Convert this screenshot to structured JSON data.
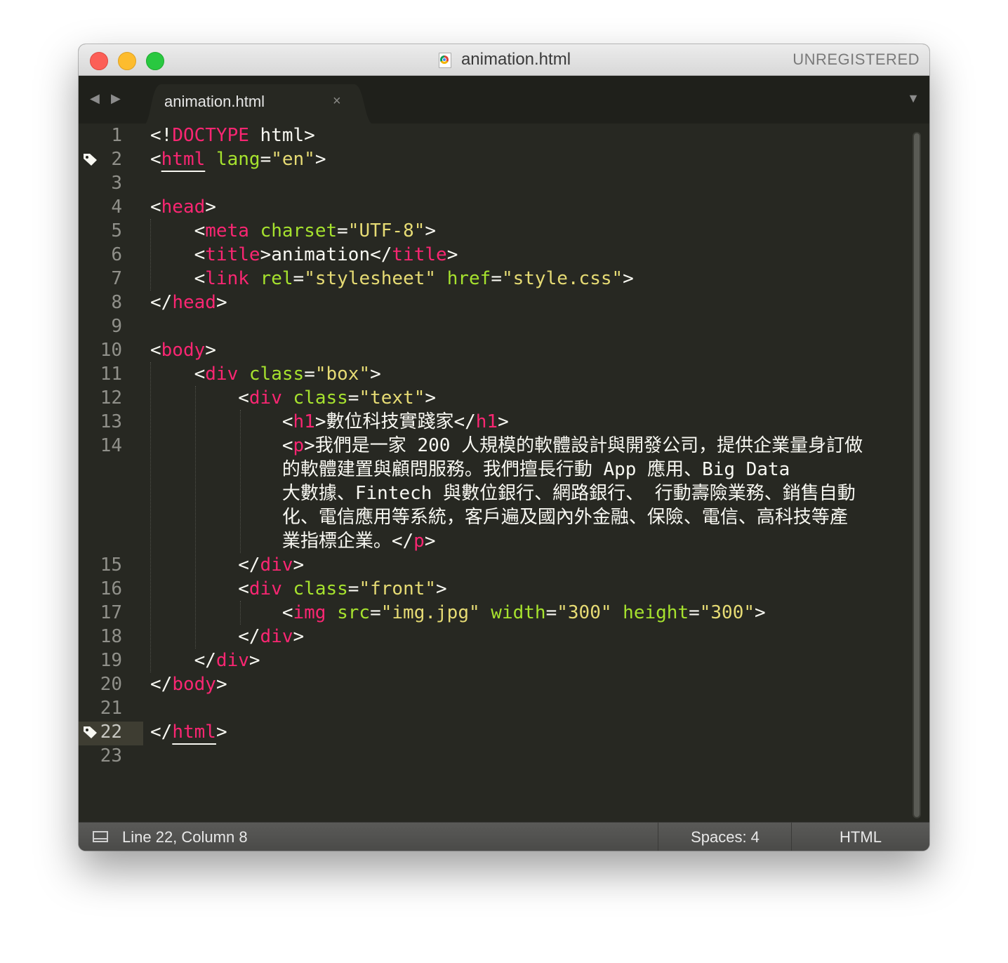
{
  "window": {
    "title": "animation.html",
    "license": "UNREGISTERED"
  },
  "tabs": {
    "back_icon": "◀",
    "forward_icon": "▶",
    "active": {
      "label": "animation.html",
      "close_icon": "×"
    },
    "menu_icon": "▼"
  },
  "editor": {
    "current_line": 22,
    "bookmarked_lines": [
      2,
      22
    ],
    "line_numbers": [
      "1",
      "2",
      "3",
      "4",
      "5",
      "6",
      "7",
      "8",
      "9",
      "10",
      "11",
      "12",
      "13",
      "14",
      "15",
      "16",
      "17",
      "18",
      "19",
      "20",
      "21",
      "22",
      "23"
    ],
    "lines": [
      [
        [
          "t",
          "<!"
        ],
        [
          "k",
          "DOCTYPE"
        ],
        [
          "t",
          " html>"
        ]
      ],
      [
        [
          "t",
          "<"
        ],
        [
          "ku",
          "html"
        ],
        [
          "t",
          " "
        ],
        [
          "a",
          "lang"
        ],
        [
          "t",
          "="
        ],
        [
          "s",
          "\"en\""
        ],
        [
          "t",
          ">"
        ]
      ],
      [],
      [
        [
          "t",
          "<"
        ],
        [
          "k",
          "head"
        ],
        [
          "t",
          ">"
        ]
      ],
      [
        [
          "t",
          "    <"
        ],
        [
          "k",
          "meta"
        ],
        [
          "t",
          " "
        ],
        [
          "a",
          "charset"
        ],
        [
          "t",
          "="
        ],
        [
          "s",
          "\"UTF-8\""
        ],
        [
          "t",
          ">"
        ]
      ],
      [
        [
          "t",
          "    <"
        ],
        [
          "k",
          "title"
        ],
        [
          "t",
          ">animation</"
        ],
        [
          "k",
          "title"
        ],
        [
          "t",
          ">"
        ]
      ],
      [
        [
          "t",
          "    <"
        ],
        [
          "k",
          "link"
        ],
        [
          "t",
          " "
        ],
        [
          "a",
          "rel"
        ],
        [
          "t",
          "="
        ],
        [
          "s",
          "\"stylesheet\""
        ],
        [
          "t",
          " "
        ],
        [
          "a",
          "href"
        ],
        [
          "t",
          "="
        ],
        [
          "s",
          "\"style.css\""
        ],
        [
          "t",
          ">"
        ]
      ],
      [
        [
          "t",
          "</"
        ],
        [
          "k",
          "head"
        ],
        [
          "t",
          ">"
        ]
      ],
      [],
      [
        [
          "t",
          "<"
        ],
        [
          "k",
          "body"
        ],
        [
          "t",
          ">"
        ]
      ],
      [
        [
          "t",
          "    <"
        ],
        [
          "k",
          "div"
        ],
        [
          "t",
          " "
        ],
        [
          "a",
          "class"
        ],
        [
          "t",
          "="
        ],
        [
          "s",
          "\"box\""
        ],
        [
          "t",
          ">"
        ]
      ],
      [
        [
          "t",
          "        <"
        ],
        [
          "k",
          "div"
        ],
        [
          "t",
          " "
        ],
        [
          "a",
          "class"
        ],
        [
          "t",
          "="
        ],
        [
          "s",
          "\"text\""
        ],
        [
          "t",
          ">"
        ]
      ],
      [
        [
          "t",
          "            <"
        ],
        [
          "k",
          "h1"
        ],
        [
          "t",
          ">數位科技實踐家</"
        ],
        [
          "k",
          "h1"
        ],
        [
          "t",
          ">"
        ]
      ],
      [
        [
          "t",
          "            <"
        ],
        [
          "k",
          "p"
        ],
        [
          "t",
          ">我們是一家 200 人規模的軟體設計與開發公司，提供企業量身訂做"
        ]
      ],
      [
        [
          "t",
          "            的軟體建置與顧問服務。我們擅長行動 App 應用、Big Data"
        ]
      ],
      [
        [
          "t",
          "            大數據、Fintech 與數位銀行、網路銀行、 行動壽險業務、銷售自動"
        ]
      ],
      [
        [
          "t",
          "            化、電信應用等系統，客戶遍及國內外金融、保險、電信、高科技等產"
        ]
      ],
      [
        [
          "t",
          "            業指標企業。</"
        ],
        [
          "k",
          "p"
        ],
        [
          "t",
          ">"
        ]
      ],
      [
        [
          "t",
          "        </"
        ],
        [
          "k",
          "div"
        ],
        [
          "t",
          ">"
        ]
      ],
      [
        [
          "t",
          "        <"
        ],
        [
          "k",
          "div"
        ],
        [
          "t",
          " "
        ],
        [
          "a",
          "class"
        ],
        [
          "t",
          "="
        ],
        [
          "s",
          "\"front\""
        ],
        [
          "t",
          ">"
        ]
      ],
      [
        [
          "t",
          "            <"
        ],
        [
          "k",
          "img"
        ],
        [
          "t",
          " "
        ],
        [
          "a",
          "src"
        ],
        [
          "t",
          "="
        ],
        [
          "s",
          "\"img.jpg\""
        ],
        [
          "t",
          " "
        ],
        [
          "a",
          "width"
        ],
        [
          "t",
          "="
        ],
        [
          "s",
          "\"300\""
        ],
        [
          "t",
          " "
        ],
        [
          "a",
          "height"
        ],
        [
          "t",
          "="
        ],
        [
          "s",
          "\"300\""
        ],
        [
          "t",
          ">"
        ]
      ],
      [
        [
          "t",
          "        </"
        ],
        [
          "k",
          "div"
        ],
        [
          "t",
          ">"
        ]
      ],
      [
        [
          "t",
          "    </"
        ],
        [
          "k",
          "div"
        ],
        [
          "t",
          ">"
        ]
      ],
      [
        [
          "t",
          "</"
        ],
        [
          "k",
          "body"
        ],
        [
          "t",
          ">"
        ]
      ],
      [],
      [
        [
          "t",
          "</"
        ],
        [
          "ku",
          "html"
        ],
        [
          "t",
          ">"
        ]
      ],
      []
    ]
  },
  "status": {
    "position": "Line 22, Column 8",
    "indentation": "Spaces: 4",
    "syntax": "HTML"
  },
  "colors": {
    "background": "#272822",
    "keyword": "#f92672",
    "attribute": "#a6e22e",
    "string": "#e6db74",
    "text": "#f8f8f2"
  }
}
